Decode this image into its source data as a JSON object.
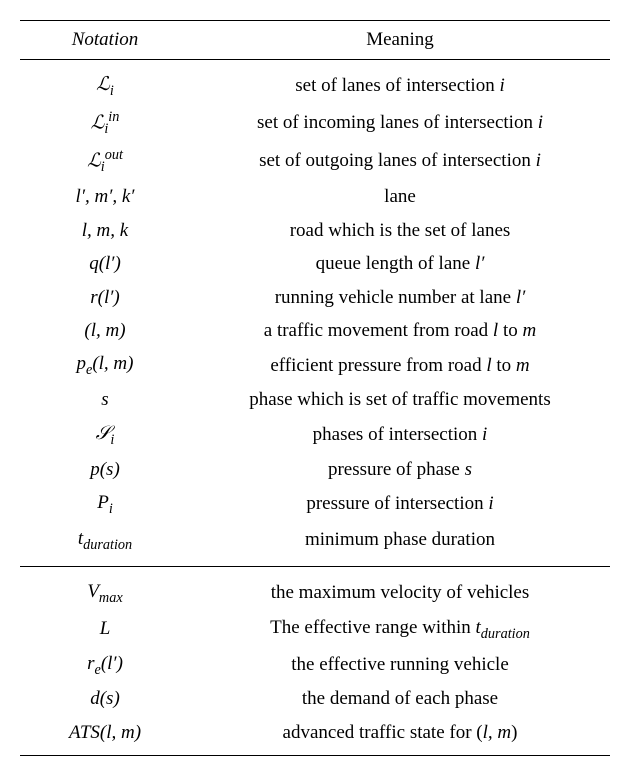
{
  "headers": {
    "notation": "Notation",
    "meaning": "Meaning"
  },
  "section1": [
    {
      "notation": "ℒ<sub>i</sub>",
      "meaning": "set of lanes of intersection <i>i</i>"
    },
    {
      "notation": "ℒ<sub>i</sub><sup>in</sup>",
      "meaning": "set of incoming lanes of intersection <i>i</i>"
    },
    {
      "notation": "ℒ<sub>i</sub><sup>out</sup>",
      "meaning": "set of outgoing lanes of intersection <i>i</i>"
    },
    {
      "notation": "<i>l′, m′, k′</i>",
      "meaning": "lane"
    },
    {
      "notation": "<i>l, m, k</i>",
      "meaning": "road which is the set of lanes"
    },
    {
      "notation": "<i>q</i>(<i>l′</i>)",
      "meaning": "queue length of lane <i>l′</i>"
    },
    {
      "notation": "<i>r</i>(<i>l′</i>)",
      "meaning": "running vehicle number at lane <i>l′</i>"
    },
    {
      "notation": "(<i>l, m</i>)",
      "meaning": "a traffic movement from road <i>l</i> to <i>m</i>"
    },
    {
      "notation": "<i>p<sub>e</sub></i>(<i>l, m</i>)",
      "meaning": "efficient pressure from road <i>l</i> to <i>m</i>"
    },
    {
      "notation": "<i>s</i>",
      "meaning": "phase which is set of traffic movements"
    },
    {
      "notation": "𝒮<sub>i</sub>",
      "meaning": "phases of intersection <i>i</i>"
    },
    {
      "notation": "<i>p</i>(<i>s</i>)",
      "meaning": "pressure of phase <i>s</i>"
    },
    {
      "notation": "<i>P<sub>i</sub></i>",
      "meaning": "pressure of intersection <i>i</i>"
    },
    {
      "notation": "<i>t<sub>duration</sub></i>",
      "meaning": "minimum phase duration"
    }
  ],
  "section2": [
    {
      "notation": "<i>V<sub>max</sub></i>",
      "meaning": "the maximum velocity of vehicles"
    },
    {
      "notation": "<i>L</i>",
      "meaning": "The effective range within <i>t<sub>duration</sub></i>"
    },
    {
      "notation": "<i>r<sub>e</sub></i>(<i>l′</i>)",
      "meaning": "the effective running vehicle"
    },
    {
      "notation": "<i>d</i>(<i>s</i>)",
      "meaning": "the demand of each phase"
    },
    {
      "notation": "<i>ATS</i>(<i>l, m</i>)",
      "meaning": "advanced traffic state for (<i>l, m</i>)"
    }
  ]
}
